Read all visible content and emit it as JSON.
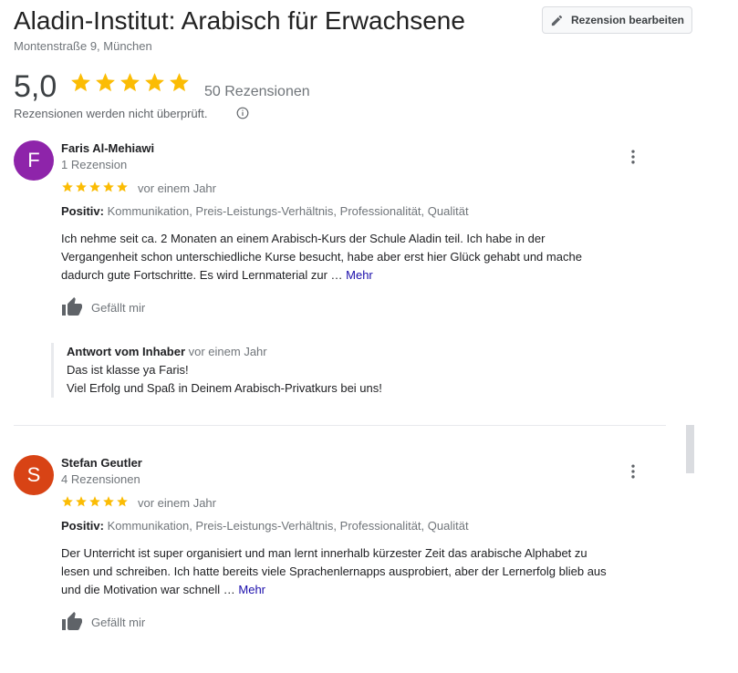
{
  "header": {
    "title": "Aladin-Institut: Arabisch für Erwachsene",
    "address": "Montenstraße 9, München",
    "edit_button": "Rezension bearbeiten"
  },
  "summary": {
    "rating": "5,0",
    "stars": 5,
    "count_label": "50 Rezensionen",
    "notice": "Rezensionen werden nicht überprüft."
  },
  "colors": {
    "star": "#fbbc04",
    "avatar_faris": "#8e24aa",
    "avatar_stefan": "#d84315"
  },
  "reviews": [
    {
      "initial": "F",
      "name": "Faris Al-Mehiawi",
      "subtitle": "1 Rezension",
      "stars": 5,
      "time": "vor einem Jahr",
      "tags_label": "Positiv:",
      "tags": "Kommunikation, Preis-Leistungs-Verhältnis, Professionalität, Qualität",
      "text_lines": [
        "Ich nehme seit ca. 2 Monaten an einem Arabisch-Kurs der Schule Aladin teil. Ich habe in der",
        "Vergangenheit schon unterschiedliche Kurse besucht, habe aber erst hier Glück gehabt und mache",
        "dadurch gute Fortschritte. Es wird Lernmaterial zur …"
      ],
      "more_label": "Mehr",
      "like_label": "Gefällt mir",
      "owner_reply": {
        "label": "Antwort vom Inhaber",
        "time": "vor einem Jahr",
        "lines": [
          "Das ist klasse ya Faris!",
          "Viel Erfolg und Spaß in Deinem Arabisch-Privatkurs bei uns!"
        ]
      }
    },
    {
      "initial": "S",
      "name": "Stefan Geutler",
      "subtitle": "4 Rezensionen",
      "stars": 5,
      "time": "vor einem Jahr",
      "tags_label": "Positiv:",
      "tags": "Kommunikation, Preis-Leistungs-Verhältnis, Professionalität, Qualität",
      "text_lines": [
        "Der Unterricht ist super organisiert und man lernt innerhalb kürzester Zeit das arabische Alphabet zu",
        "lesen und schreiben. Ich hatte bereits viele Sprachenlernapps ausprobiert, aber der Lernerfolg blieb aus",
        "und die Motivation war schnell …"
      ],
      "more_label": "Mehr",
      "like_label": "Gefällt mir"
    }
  ]
}
